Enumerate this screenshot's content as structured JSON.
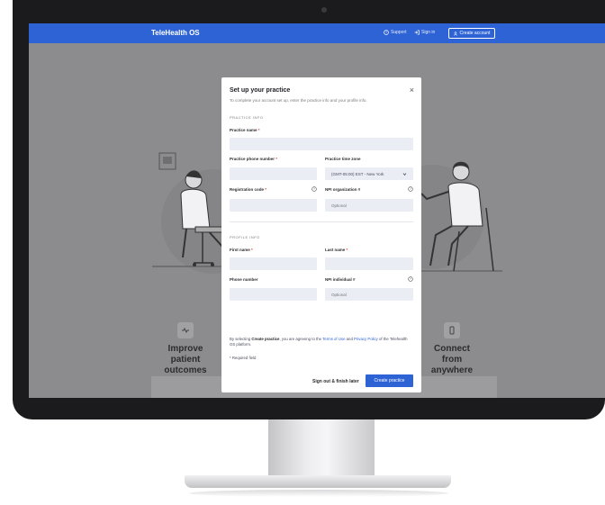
{
  "header": {
    "brand": "TeleHealth OS",
    "support_label": "Support",
    "signin_label": "Sign in",
    "create_account_label": "Create account"
  },
  "background": {
    "feature_left": "Improve patient outcomes",
    "feature_right": "Connect from anywhere"
  },
  "modal": {
    "title": "Set up your practice",
    "subtitle": "To complete your account set up, enter the practice info and your profile info.",
    "practice_section": "PRACTICE INFO",
    "practice_name_label": "Practice name",
    "practice_phone_label": "Practice phone number",
    "practice_timezone_label": "Practice time zone",
    "timezone_value": "(GMT-05:00) EST - New York",
    "registration_code_label": "Registration code",
    "npi_org_label": "NPI organization #",
    "npi_org_placeholder": "Optional",
    "profile_section": "PROFILE INFO",
    "first_name_label": "First name",
    "last_name_label": "Last name",
    "phone_label": "Phone number",
    "npi_individual_label": "NPI individual #",
    "npi_individual_placeholder": "Optional",
    "terms_prefix": "By selecting",
    "terms_action": "Create practice",
    "terms_middle": ", you are agreeing to the",
    "terms_link": "Terms of Use",
    "terms_and": "and",
    "privacy_link": "Privacy Policy",
    "terms_suffix": "of the Telehealth OS platform.",
    "required_note": "* Required field",
    "sign_out_label": "Sign out & finish later",
    "create_practice_label": "Create practice"
  },
  "colors": {
    "brand_blue": "#2e63d6",
    "required_red": "#e0443c",
    "input_bg": "#ebedf5"
  }
}
